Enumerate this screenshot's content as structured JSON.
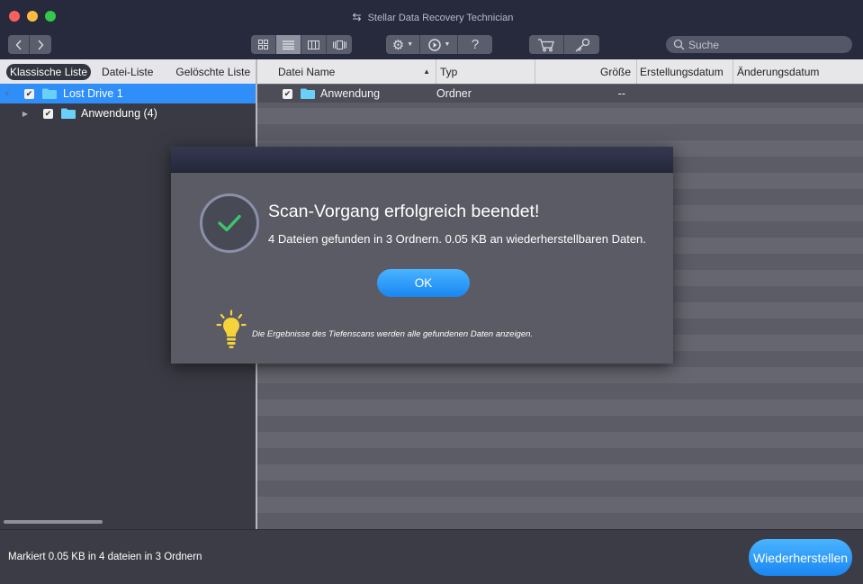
{
  "window": {
    "title": "Stellar Data Recovery Technician"
  },
  "search": {
    "placeholder": "Suche"
  },
  "left_pane": {
    "tabs": [
      {
        "label": "Klassische Liste",
        "active": true
      },
      {
        "label": "Datei-Liste",
        "active": false
      },
      {
        "label": "Gelöschte Liste",
        "active": false
      }
    ],
    "tree": [
      {
        "label": "Lost Drive 1",
        "checked": true,
        "selected": true
      },
      {
        "label": "Anwendung (4)",
        "checked": true,
        "selected": false
      }
    ]
  },
  "table": {
    "columns": [
      "Datei Name",
      "Typ",
      "Größe",
      "Erstellungsdatum",
      "Änderungsdatum"
    ],
    "rows": [
      {
        "name": "Anwendung",
        "type": "Ordner",
        "size": "--",
        "created": "",
        "modified": ""
      }
    ]
  },
  "dialog": {
    "title": "Scan-Vorgang erfolgreich beendet!",
    "message": "4 Dateien gefunden in 3 Ordnern. 0.05 KB an wiederherstellbaren Daten.",
    "ok_label": "OK",
    "tip": "Die Ergebnisse des Tiefenscans werden alle gefundenen Daten anzeigen."
  },
  "status": {
    "text": "Markiert 0.05 KB in 4 dateien in 3 Ordnern",
    "restore_label": "Wiederherstellen"
  },
  "toolbar": {
    "help_label": "?"
  },
  "colors": {
    "accent": "#2f8ef7",
    "check": "#3ec46d",
    "bulb": "#f5d43b",
    "titlebar": "#262a3c"
  }
}
